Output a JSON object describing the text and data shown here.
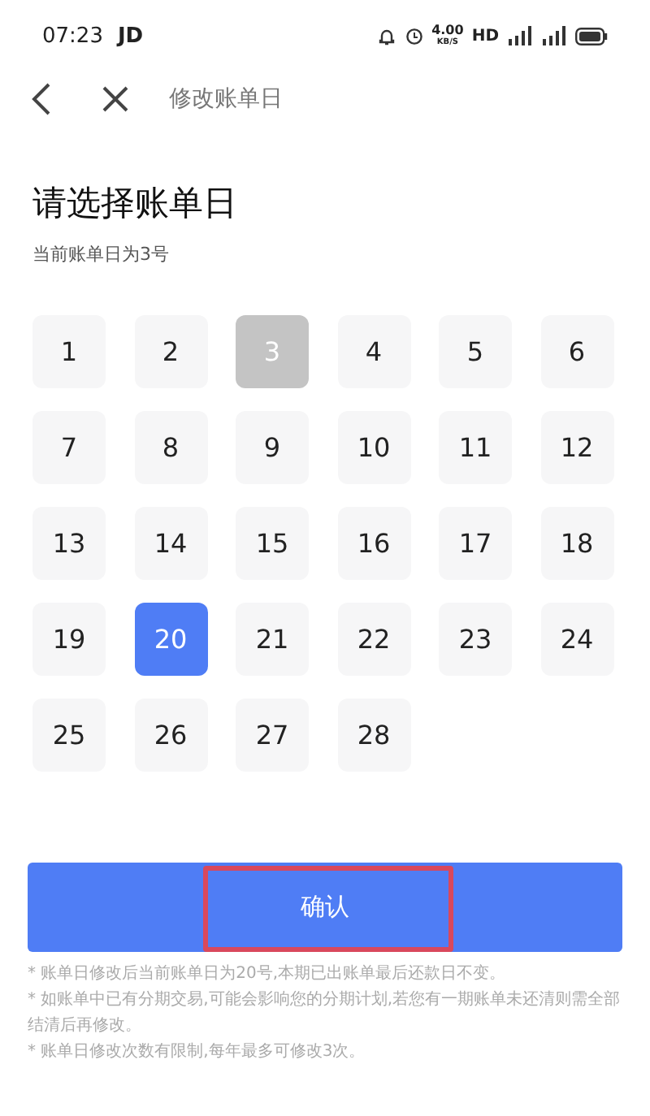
{
  "status_bar": {
    "time": "07:23",
    "carrier": "JD",
    "speed": "4.00",
    "speed_unit": "KB/S",
    "hd": "HD"
  },
  "nav": {
    "title": "修改账单日"
  },
  "heading": "请选择账单日",
  "subtitle": "当前账单日为3号",
  "days": [
    {
      "label": "1",
      "selected": false,
      "disabled": false
    },
    {
      "label": "2",
      "selected": false,
      "disabled": false
    },
    {
      "label": "3",
      "selected": false,
      "disabled": true
    },
    {
      "label": "4",
      "selected": false,
      "disabled": false
    },
    {
      "label": "5",
      "selected": false,
      "disabled": false
    },
    {
      "label": "6",
      "selected": false,
      "disabled": false
    },
    {
      "label": "7",
      "selected": false,
      "disabled": false
    },
    {
      "label": "8",
      "selected": false,
      "disabled": false
    },
    {
      "label": "9",
      "selected": false,
      "disabled": false
    },
    {
      "label": "10",
      "selected": false,
      "disabled": false
    },
    {
      "label": "11",
      "selected": false,
      "disabled": false
    },
    {
      "label": "12",
      "selected": false,
      "disabled": false
    },
    {
      "label": "13",
      "selected": false,
      "disabled": false
    },
    {
      "label": "14",
      "selected": false,
      "disabled": false
    },
    {
      "label": "15",
      "selected": false,
      "disabled": false
    },
    {
      "label": "16",
      "selected": false,
      "disabled": false
    },
    {
      "label": "17",
      "selected": false,
      "disabled": false
    },
    {
      "label": "18",
      "selected": false,
      "disabled": false
    },
    {
      "label": "19",
      "selected": false,
      "disabled": false
    },
    {
      "label": "20",
      "selected": true,
      "disabled": false
    },
    {
      "label": "21",
      "selected": false,
      "disabled": false
    },
    {
      "label": "22",
      "selected": false,
      "disabled": false
    },
    {
      "label": "23",
      "selected": false,
      "disabled": false
    },
    {
      "label": "24",
      "selected": false,
      "disabled": false
    },
    {
      "label": "25",
      "selected": false,
      "disabled": false
    },
    {
      "label": "26",
      "selected": false,
      "disabled": false
    },
    {
      "label": "27",
      "selected": false,
      "disabled": false
    },
    {
      "label": "28",
      "selected": false,
      "disabled": false
    }
  ],
  "confirm_button": {
    "label": "确认",
    "highlighted": true
  },
  "notes": [
    "* 账单日修改后当前账单日为20号,本期已出账单最后还款日不变。",
    "* 如账单中已有分期交易,可能会影响您的分期计划,若您有一期账单未还清则需全部结清后再修改。",
    "* 账单日修改次数有限制,每年最多可修改3次。"
  ]
}
